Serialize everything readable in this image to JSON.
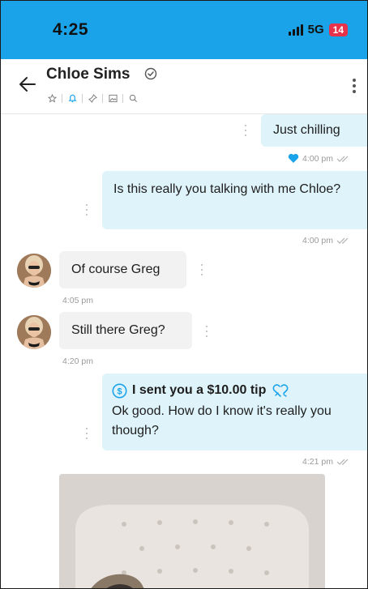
{
  "status_bar": {
    "time": "4:25",
    "network": "5G",
    "battery": "14"
  },
  "header": {
    "contact_name": "Chloe Sims"
  },
  "messages": [
    {
      "direction": "out",
      "text": "Just chilling",
      "time": "4:00 pm",
      "liked": true
    },
    {
      "direction": "out",
      "text": "Is this really you talking with me Chloe?",
      "time": "4:00 pm"
    },
    {
      "direction": "in",
      "text": "Of course Greg",
      "time": "4:05 pm"
    },
    {
      "direction": "in",
      "text": "Still there Greg?",
      "time": "4:20 pm"
    },
    {
      "direction": "out",
      "tip": "I sent you a $10.00 tip",
      "text": "Ok good. How do I know it's really you though?",
      "time": "4:21 pm"
    }
  ],
  "colors": {
    "accent": "#1aa3e8",
    "out_bubble": "#dff3fb",
    "in_bubble": "#f2f2f2",
    "battery": "#e8314a",
    "heart": "#1aa3e8"
  },
  "icons": [
    "back-arrow-icon",
    "verified-icon",
    "star-icon",
    "bell-icon",
    "pin-icon",
    "image-icon",
    "search-icon",
    "more-vertical-icon",
    "heart-icon",
    "double-check-icon",
    "dollar-icon",
    "tip-heart-icon"
  ]
}
